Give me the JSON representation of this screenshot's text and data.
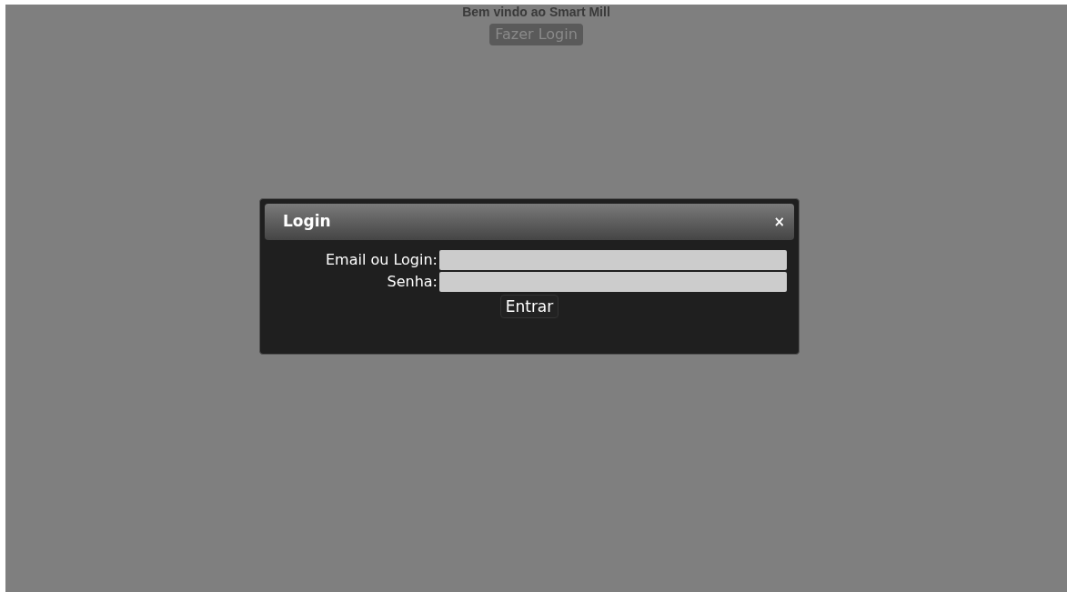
{
  "page": {
    "heading": "Bem vindo ao Smart Mill",
    "login_button": "Fazer Login"
  },
  "dialog": {
    "title": "Login",
    "close": "×",
    "fields": [
      {
        "label": "Email ou Login:"
      },
      {
        "label": "Senha:"
      }
    ],
    "submit": "Entrar"
  }
}
